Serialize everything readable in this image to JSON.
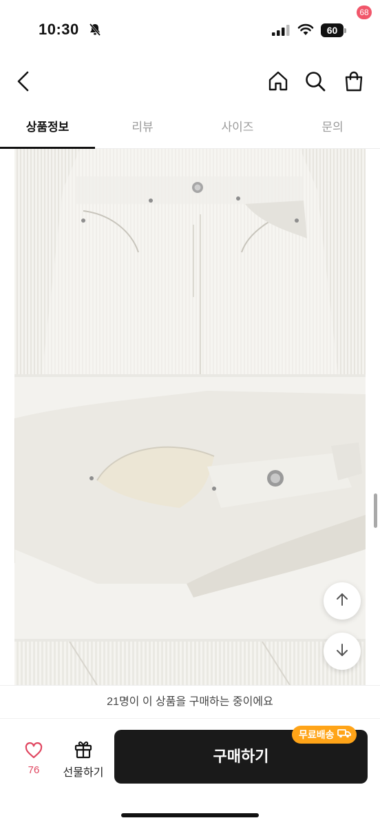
{
  "status_bar": {
    "time": "10:30",
    "battery_level": "60",
    "icons": [
      "bell-slash-icon",
      "cellular-signal-icon",
      "wifi-icon",
      "battery-icon"
    ]
  },
  "header": {
    "icons": [
      "back-arrow-icon",
      "home-icon",
      "search-icon",
      "shopping-bag-icon"
    ],
    "cart_count": "68"
  },
  "tabs": [
    {
      "label": "상품정보",
      "active": true
    },
    {
      "label": "리뷰",
      "active": false
    },
    {
      "label": "사이즈",
      "active": false
    },
    {
      "label": "문의",
      "active": false
    }
  ],
  "scroll_buttons": [
    "arrow-up-icon",
    "arrow-down-icon"
  ],
  "notice": {
    "text": "21명이 이 상품을 구매하는 중이에요"
  },
  "bottom_bar": {
    "like_count": "76",
    "gift_label": "선물하기",
    "buy_label": "구매하기",
    "shipping_badge": "무료배송"
  },
  "colors": {
    "accent_pink": "#f1566a",
    "like_red": "#e04660",
    "shipping_orange": "#ffa418",
    "buy_button": "#1a1a1a"
  }
}
